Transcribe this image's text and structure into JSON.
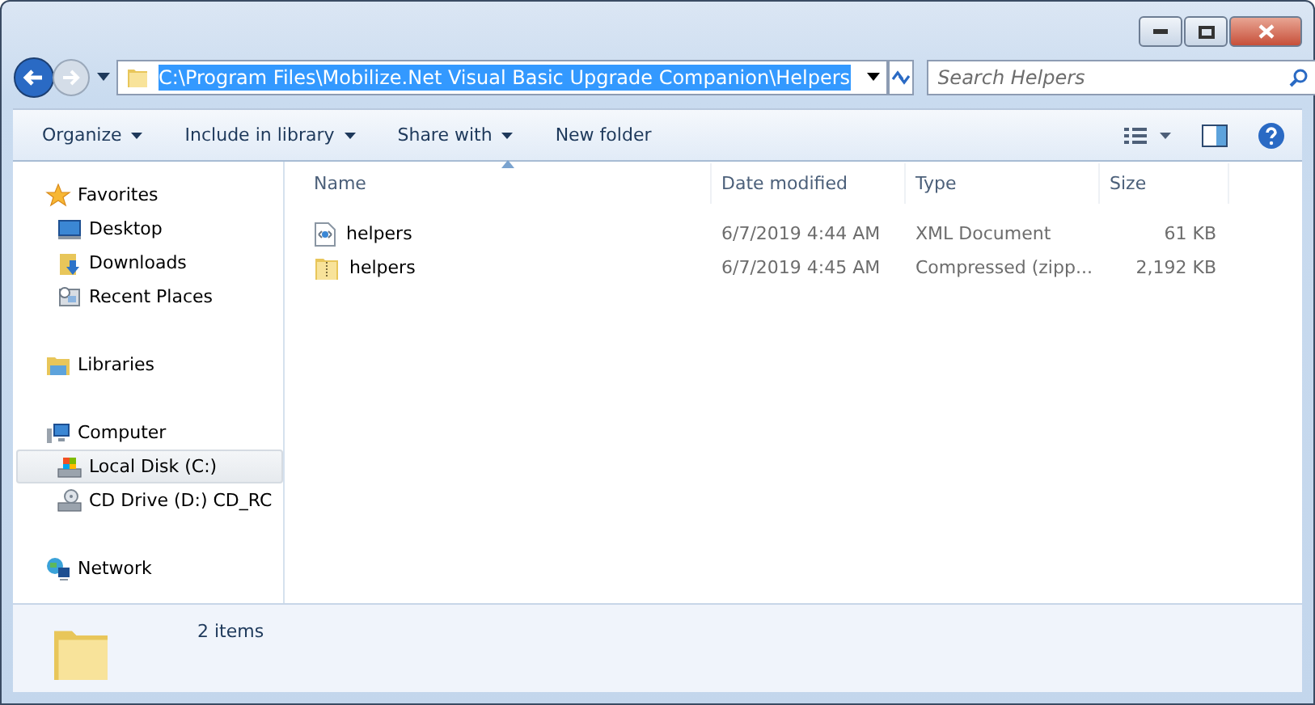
{
  "address": {
    "value": "C:\\Program Files\\Mobilize.Net Visual Basic Upgrade Companion\\Helpers",
    "selected": true
  },
  "search": {
    "placeholder": "Search Helpers"
  },
  "toolbar": [
    {
      "label": "Organize",
      "dropdown": true
    },
    {
      "label": "Include in library",
      "dropdown": true
    },
    {
      "label": "Share with",
      "dropdown": true
    },
    {
      "label": "New folder",
      "dropdown": false
    }
  ],
  "sidebar": [
    {
      "label": "Favorites",
      "kind": "star",
      "children": [
        {
          "label": "Desktop",
          "kind": "desktop",
          "selected": false
        },
        {
          "label": "Downloads",
          "kind": "downloads",
          "selected": false
        },
        {
          "label": "Recent Places",
          "kind": "recent",
          "selected": false
        }
      ]
    },
    {
      "label": "Libraries",
      "kind": "libraries"
    },
    {
      "label": "Computer",
      "kind": "computer",
      "children": [
        {
          "label": "Local Disk (C:)",
          "kind": "disk",
          "selected": true
        },
        {
          "label": "CD Drive (D:) CD_RC",
          "kind": "cd",
          "selected": false
        }
      ]
    },
    {
      "label": "Network",
      "kind": "network"
    }
  ],
  "columns": [
    {
      "label": "Name",
      "sorted": true
    },
    {
      "label": "Date modified",
      "sorted": false
    },
    {
      "label": "Type",
      "sorted": false
    },
    {
      "label": "Size",
      "sorted": false
    }
  ],
  "files": [
    {
      "name": "helpers",
      "date": "6/7/2019 4:44 AM",
      "type": "XML Document",
      "size": "61 KB",
      "kind": "xml"
    },
    {
      "name": "helpers",
      "date": "6/7/2019 4:45 AM",
      "type": "Compressed (zipp...",
      "size": "2,192 KB",
      "kind": "zip"
    }
  ],
  "status": {
    "count": "2 items"
  }
}
